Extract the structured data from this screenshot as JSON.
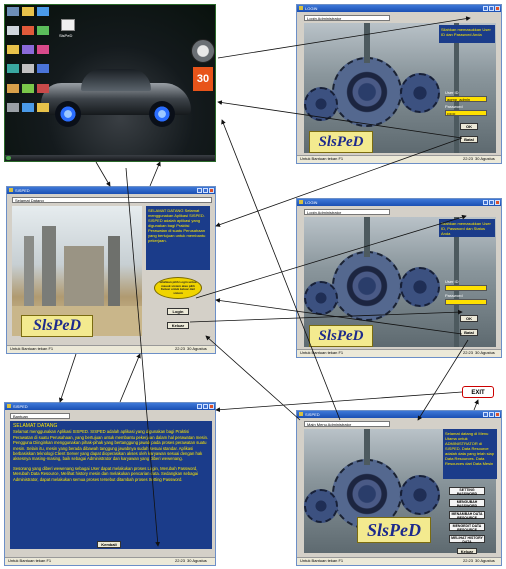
{
  "desktop": {
    "tile_number": "30",
    "icon_label": "SlsPeD"
  },
  "login1": {
    "title": "LOGIN",
    "label_bar": "Login Administrator",
    "info_text": "Silahkan memasukkan User ID dan Password Anda",
    "user_id_label": "User ID",
    "user_id_value": "aqmp_admin",
    "password_label": "Password",
    "password_value": "••••••",
    "ok_label": "OK",
    "exit_label": "Batal",
    "logo": "SlsPeD",
    "status_left": "Untuk Bantuan tekan F1",
    "status_time": "22:23",
    "status_date": "30 Agustus 2010"
  },
  "login2": {
    "title": "LOGIN",
    "label_bar": "Login Administrator",
    "info_text": "Silahkan memasukkan User ID, Password dan Status Anda",
    "user_id_label": "User ID",
    "password_label": "Password",
    "ok_label": "OK",
    "exit_label": "Batal",
    "logo": "SlsPeD",
    "status_left": "Untuk Bantuan tekan F1",
    "status_time": "22:23",
    "status_date": "30 Agustus 2010"
  },
  "splash": {
    "title": "SISPED",
    "label_bar": "Selamat Datang",
    "info_text": "SELAMAT DATANG Selamat menggunakan Aplikasi SISPED. SISPED adalah aplikasi yang digunakan bagi Praktisi Perawatan di suatu Perusahaan yang bertujuan untuk membantu pekerjaan.",
    "callout": "Silahkan pilih Login untuk masuk sistem atau pilih Keluar untuk keluar dari sistem",
    "login_label": "Login",
    "exit_label": "Keluar",
    "logo": "SlsPeD",
    "status_left": "Untuk Bantuan tekan F1",
    "status_time": "22:23",
    "status_date": "30 Agustus 2010"
  },
  "welcome": {
    "title": "SISPED",
    "label_bar": "Bantuan",
    "heading": "SELAMAT DATANG",
    "paragraph1": "Selamat menggunakan Aplikasi SISPED. SISPED adalah aplikasi yang digunakan bagi Praktisi Perawatan di suatu Perusahaan, yang bertujuan untuk membantu pekerjaan dalam hal perawatan mesin. Pengguna Diinginkan menggunakan pihak-pihak yang bertanggung jawab pada proses perawatan suatu mesin. Selain itu, mesin yang berada dibawah tanggung jawabnya sudah sesuai standar. Aplikasi berbasiskan teknologi Client Server yang dapat dioperasikan akses oleh karyawan sesuai dengan hak aksesnya masing-masing, baik sebagai Administrator dan karyawan yang diberi wewenang.",
    "paragraph2": "Sesorang yang diberi wewenang sebagai User dapat melakukan proses Login, Merubah Password, Merubah Data Resource, Melihat history mesin dan melakukan pencarian data. Sedangkan sebagai Administrator, dapat melakukan semua proses tersebut ditambah proses Setting Password.",
    "back_label": "Kembali",
    "status_left": "Untuk Bantuan tekan F1",
    "status_time": "22:23",
    "status_date": "30 Agustus 2010"
  },
  "menu": {
    "title": "SISPED",
    "label_bar": "Main Menu Administrator",
    "info_text": "Selamat datang di Menu Utama untuk ADMINISTRATOR di SISPED. Data Resource adalah data yang telah siap Data Resources. Data Resources dari Data Mesin",
    "buttons": [
      "SETTING PASSWORD",
      "MENGUBAH PASSWORD",
      "MENAMBAH DATA RESOURCE",
      "MENGEDIT DATA RESOURCE",
      "MELIHAT HISTORY DATA"
    ],
    "exit_label": "Keluar",
    "logo": "SlsPeD",
    "status_left": "Untuk Bantuan tekan F1",
    "status_time": "22:23",
    "status_date": "30 Agustus 2010"
  },
  "exit_box": {
    "label": "EXIT"
  },
  "colors": {
    "titlebar": "#1b4fb3",
    "info_box": "#1b3c8a",
    "info_text": "#ffe800",
    "field": "#ffe100",
    "exit_border": "#cc0000"
  }
}
